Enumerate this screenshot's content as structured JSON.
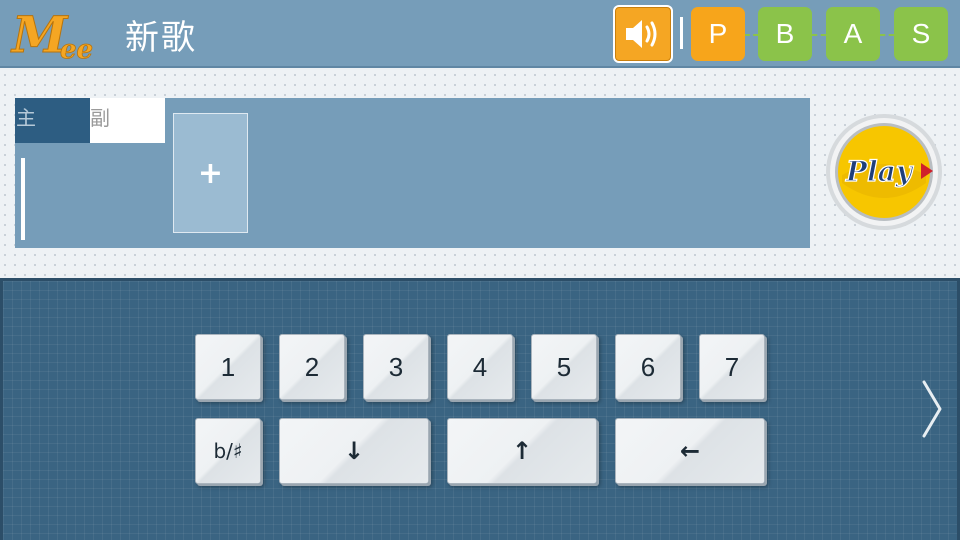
{
  "header": {
    "logo_text": "Mee",
    "title": "新歌",
    "levels": [
      {
        "label": "P",
        "color": "#f7a51b",
        "active": true
      },
      {
        "label": "B",
        "color": "#8bc34a",
        "active": false
      },
      {
        "label": "A",
        "color": "#8bc34a",
        "active": false
      },
      {
        "label": "S",
        "color": "#8bc34a",
        "active": false
      }
    ],
    "sound_icon": "speaker-on-icon"
  },
  "editor": {
    "tabs": {
      "main": "主",
      "sub": "副"
    },
    "add_label": "+",
    "play_label": "Play"
  },
  "keyboard": {
    "digit_keys": [
      "1",
      "2",
      "3",
      "4",
      "5",
      "6",
      "7"
    ],
    "accidental_key": "b/♯",
    "down_key": "↓",
    "up_key": "↑",
    "backspace_key": "←",
    "next_icon": "chevron-right-icon"
  },
  "colors": {
    "header_bg": "#769db9",
    "accent_orange": "#f7a51b",
    "level_green": "#8bc34a",
    "keyboard_bg": "#3a6482",
    "tab_active": "#2d5d82"
  }
}
